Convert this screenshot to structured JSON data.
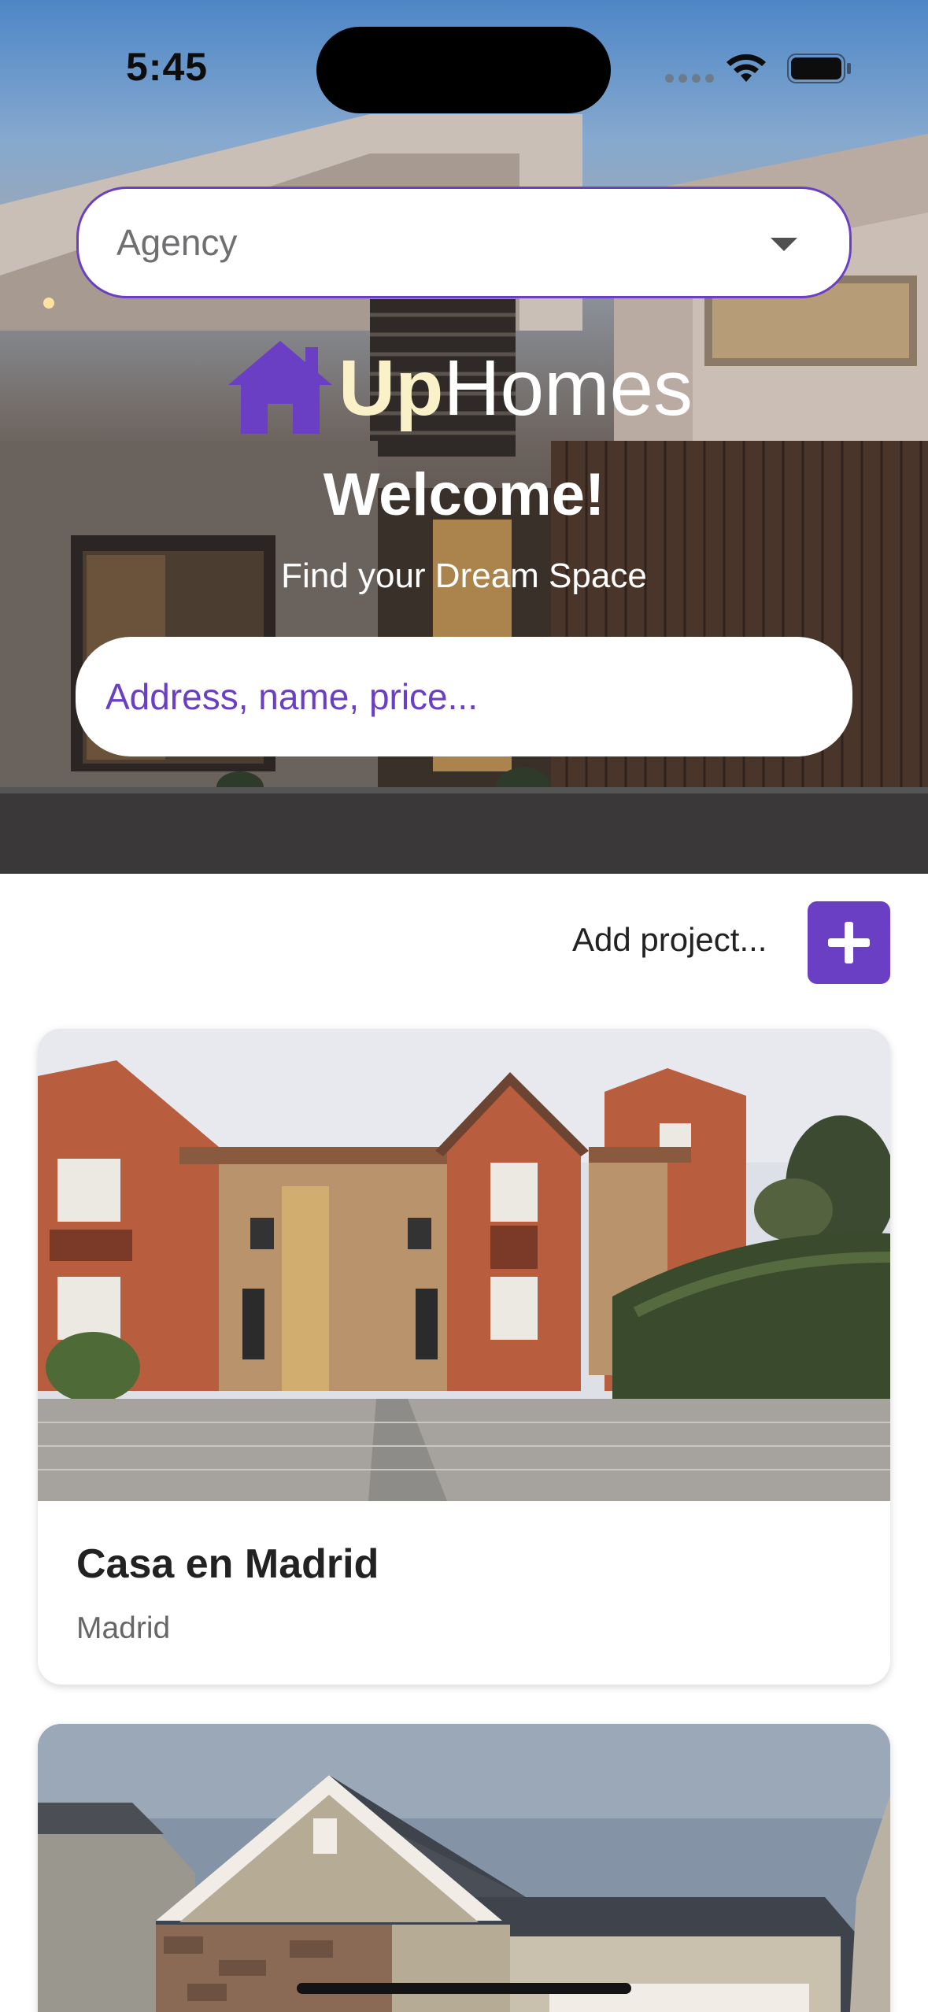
{
  "status_bar": {
    "time": "5:45"
  },
  "filter": {
    "agency_label": "Agency"
  },
  "brand": {
    "logo_up": "Up",
    "logo_homes": "Homes"
  },
  "hero": {
    "welcome": "Welcome!",
    "tagline": "Find your Dream Space",
    "search_placeholder": "Address, name, price..."
  },
  "actions": {
    "add_project_label": "Add project..."
  },
  "projects": [
    {
      "title": "Casa en Madrid",
      "subtitle": "Madrid"
    },
    {
      "title": "",
      "subtitle": ""
    }
  ],
  "colors": {
    "accent": "#6a3fc4",
    "logo_up": "#fbf1c8"
  }
}
